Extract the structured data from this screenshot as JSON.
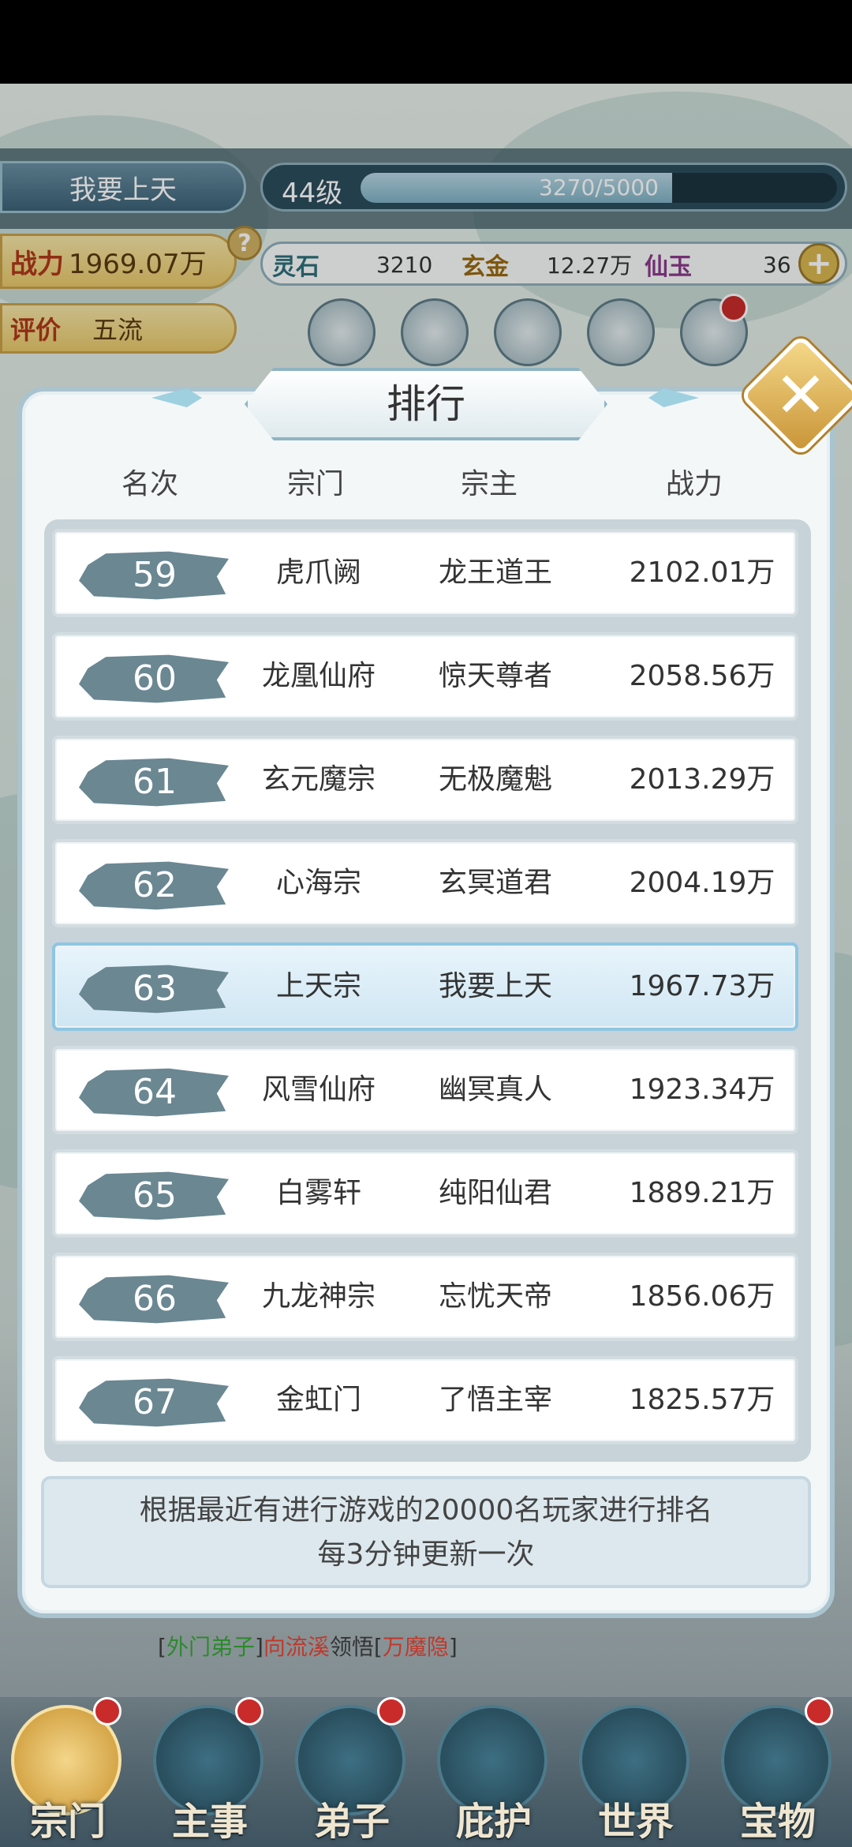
{
  "header": {
    "player_name": "我要上天",
    "level": "44级",
    "exp_text": "3270/5000",
    "exp_fraction": 0.654,
    "power_label": "战力",
    "power_value": "1969.07万",
    "help_icon": "?",
    "rating_label": "评价",
    "rating_value": "五流",
    "resources": [
      {
        "label": "灵石",
        "value": "3210"
      },
      {
        "label": "玄金",
        "value": "12.27万"
      },
      {
        "label": "仙玉",
        "value": "36"
      }
    ],
    "plus_icon": "+"
  },
  "dialog": {
    "title": "排行",
    "close_icon": "✕",
    "columns": [
      "名次",
      "宗门",
      "宗主",
      "战力"
    ],
    "rows": [
      {
        "rank": "59",
        "sect": "虎爪阙",
        "leader": "龙王道王",
        "power": "2102.01万"
      },
      {
        "rank": "60",
        "sect": "龙凰仙府",
        "leader": "惊天尊者",
        "power": "2058.56万"
      },
      {
        "rank": "61",
        "sect": "玄元魔宗",
        "leader": "无极魔魁",
        "power": "2013.29万"
      },
      {
        "rank": "62",
        "sect": "心海宗",
        "leader": "玄冥道君",
        "power": "2004.19万"
      },
      {
        "rank": "63",
        "sect": "上天宗",
        "leader": "我要上天",
        "power": "1967.73万",
        "highlight": true
      },
      {
        "rank": "64",
        "sect": "风雪仙府",
        "leader": "幽冥真人",
        "power": "1923.34万"
      },
      {
        "rank": "65",
        "sect": "白雾轩",
        "leader": "纯阳仙君",
        "power": "1889.21万"
      },
      {
        "rank": "66",
        "sect": "九龙神宗",
        "leader": "忘忧天帝",
        "power": "1856.06万"
      },
      {
        "rank": "67",
        "sect": "金虹门",
        "leader": "了悟主宰",
        "power": "1825.57万"
      }
    ],
    "note_line1": "根据最近有进行游戏的20000名玩家进行排名",
    "note_line2": "每3分钟更新一次"
  },
  "chat": {
    "bracket_open": "[",
    "role": "外门弟子",
    "bracket_close": "]",
    "name": "向流溪",
    "verb": "领悟",
    "skill_open": "[",
    "skill": "万魔隐",
    "skill_close": "]"
  },
  "bottom_nav": [
    {
      "label": "宗门",
      "icon": "sect-icon"
    },
    {
      "label": "主事",
      "icon": "task-icon"
    },
    {
      "label": "弟子",
      "icon": "disciple-icon"
    },
    {
      "label": "庇护",
      "icon": "protect-icon"
    },
    {
      "label": "世界",
      "icon": "world-icon"
    },
    {
      "label": "宝物",
      "icon": "treasure-icon"
    }
  ],
  "colors": {
    "accent_gold": "#c9922d",
    "highlight_row": "#cfe6f3",
    "reddot": "#c92b2b"
  }
}
